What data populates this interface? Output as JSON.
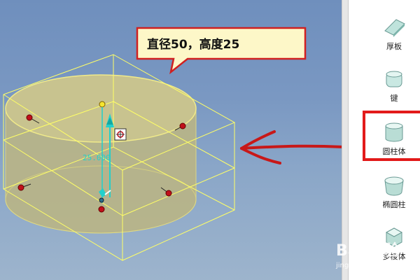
{
  "callout": {
    "text": "直径50，高度25"
  },
  "dimension": {
    "text": "25.000"
  },
  "palette": {
    "items": [
      {
        "label": "厚板"
      },
      {
        "label": "键"
      },
      {
        "label": "圆柱体"
      },
      {
        "label": "椭圆柱"
      },
      {
        "label": "多棱体"
      }
    ]
  },
  "watermark": {
    "line1": "Bai 经验",
    "line2": "jingyan.baidu.com"
  },
  "colors": {
    "cylinder": "#bdb98a",
    "highlight": "#e21a1a",
    "dimension": "#22d0cc",
    "bounding_box": "#ffff66"
  }
}
